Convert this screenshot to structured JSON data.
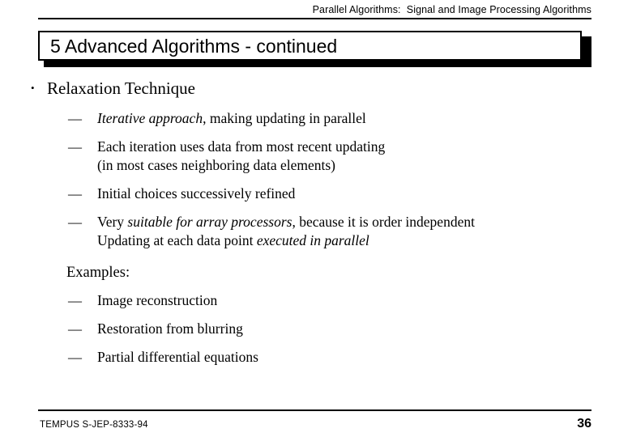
{
  "header": {
    "course_title": "Parallel Algorithms:  Signal and Image Processing Algorithms"
  },
  "title": {
    "text": "5 Advanced Algorithms - continued"
  },
  "markers": {
    "bullet": "•",
    "dash": "—"
  },
  "body": {
    "items": [
      {
        "level": 1,
        "marker": "bullet",
        "runs": [
          {
            "text": "Relaxation Technique",
            "style": "normal"
          }
        ]
      },
      {
        "level": 2,
        "marker": "dash",
        "runs": [
          {
            "text": "Iterative approach",
            "style": "italic"
          },
          {
            "text": ", making updating in parallel",
            "style": "normal"
          }
        ]
      },
      {
        "level": 2,
        "marker": "dash",
        "runs": [
          {
            "text": "Each iteration uses data from most recent updating\n(in most cases neighboring data elements)",
            "style": "normal"
          }
        ]
      },
      {
        "level": 2,
        "marker": "dash",
        "runs": [
          {
            "text": "Initial choices successively refined",
            "style": "normal"
          }
        ]
      },
      {
        "level": 2,
        "marker": "dash",
        "runs": [
          {
            "text": "Very ",
            "style": "normal"
          },
          {
            "text": "suitable for array processors",
            "style": "italic"
          },
          {
            "text": ", because it is order independent\nUpdating at each data point ",
            "style": "normal"
          },
          {
            "text": "executed in parallel",
            "style": "italic"
          }
        ]
      },
      {
        "level": 0,
        "marker": "none",
        "gap_before": true,
        "runs": [
          {
            "text": "Examples:",
            "style": "normal"
          }
        ]
      },
      {
        "level": 2,
        "marker": "dash",
        "runs": [
          {
            "text": "Image reconstruction",
            "style": "normal"
          }
        ]
      },
      {
        "level": 2,
        "marker": "dash",
        "runs": [
          {
            "text": "Restoration from blurring",
            "style": "normal"
          }
        ]
      },
      {
        "level": 2,
        "marker": "dash",
        "runs": [
          {
            "text": "Partial differential equations",
            "style": "normal"
          }
        ]
      }
    ]
  },
  "footer": {
    "project_code": "TEMPUS S-JEP-8333-94",
    "page_number": "36"
  },
  "colors": {
    "text": "#000000",
    "background": "#ffffff",
    "title_border": "#000000",
    "title_shadow": "#000000"
  }
}
